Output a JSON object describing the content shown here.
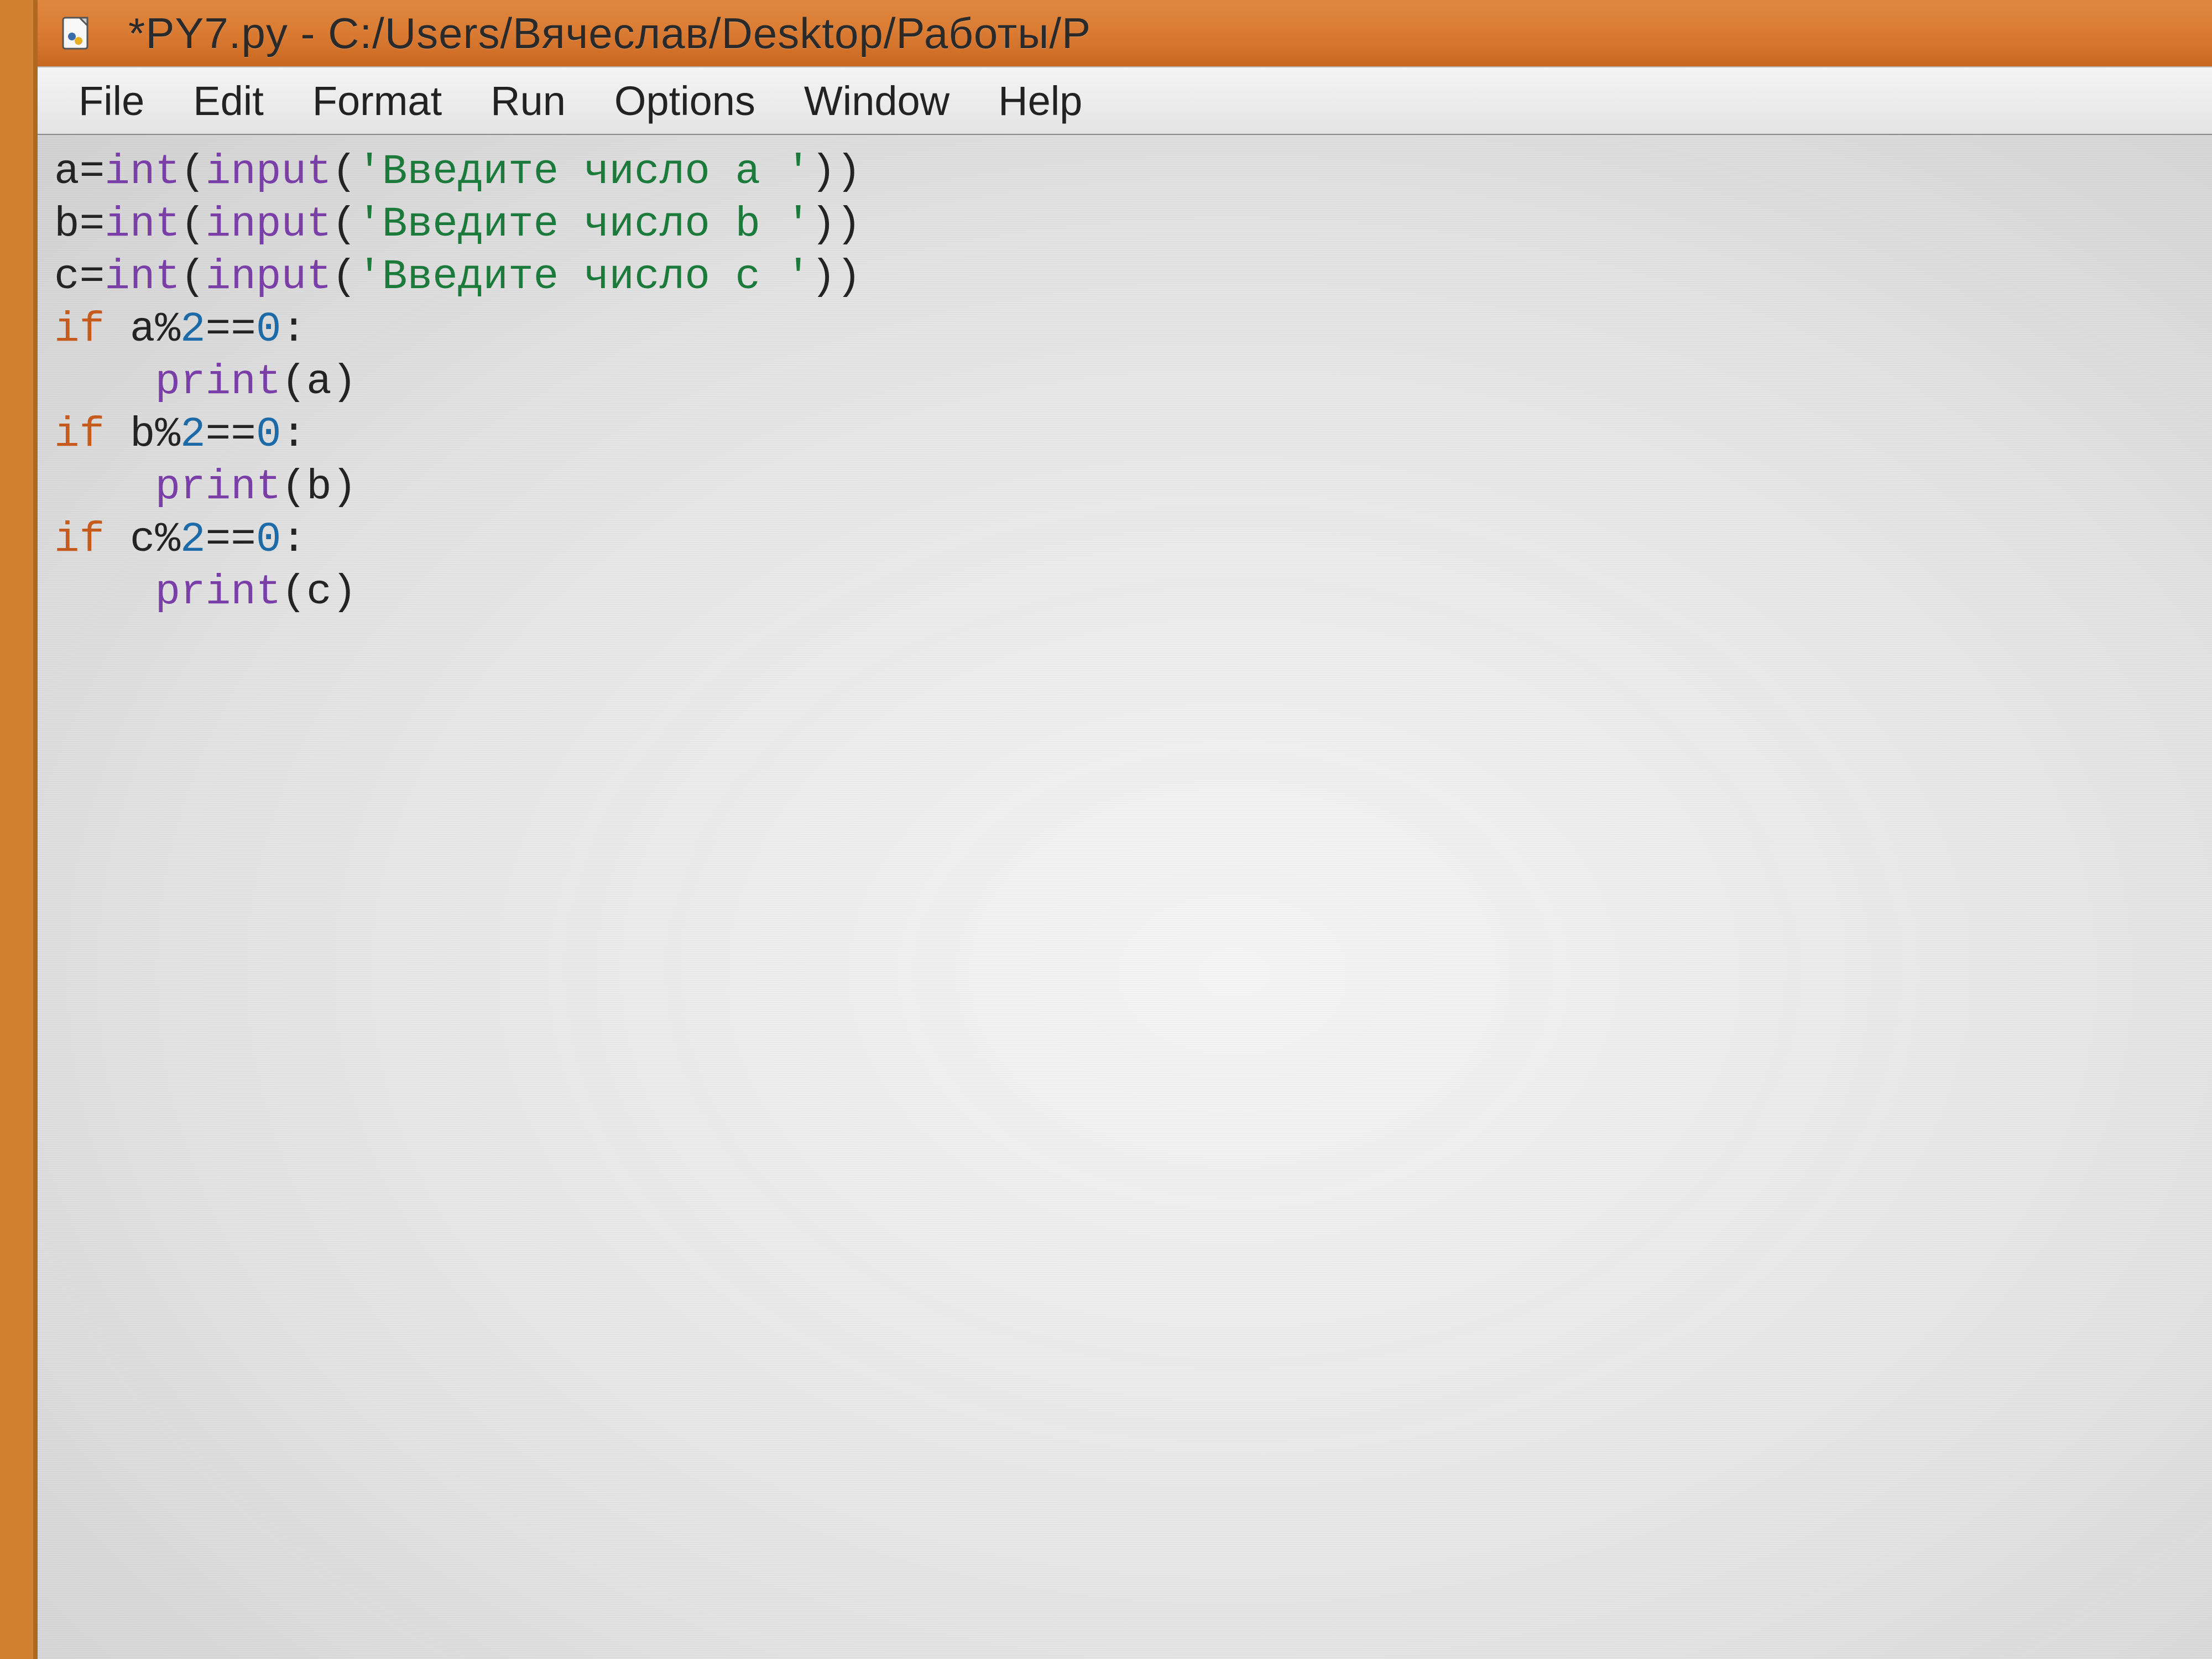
{
  "titlebar": {
    "text": "*PY7.py - C:/Users/Вячеслав/Desktop/Работы/P"
  },
  "menubar": {
    "items": [
      "File",
      "Edit",
      "Format",
      "Run",
      "Options",
      "Window",
      "Help"
    ]
  },
  "code": {
    "lines": [
      [
        {
          "t": "name",
          "v": "a"
        },
        {
          "t": "op",
          "v": "="
        },
        {
          "t": "builtin",
          "v": "int"
        },
        {
          "t": "op",
          "v": "("
        },
        {
          "t": "builtin",
          "v": "input"
        },
        {
          "t": "op",
          "v": "("
        },
        {
          "t": "string",
          "v": "'Введите число a '"
        },
        {
          "t": "op",
          "v": "))"
        }
      ],
      [
        {
          "t": "name",
          "v": "b"
        },
        {
          "t": "op",
          "v": "="
        },
        {
          "t": "builtin",
          "v": "int"
        },
        {
          "t": "op",
          "v": "("
        },
        {
          "t": "builtin",
          "v": "input"
        },
        {
          "t": "op",
          "v": "("
        },
        {
          "t": "string",
          "v": "'Введите число b '"
        },
        {
          "t": "op",
          "v": "))"
        }
      ],
      [
        {
          "t": "name",
          "v": "c"
        },
        {
          "t": "op",
          "v": "="
        },
        {
          "t": "builtin",
          "v": "int"
        },
        {
          "t": "op",
          "v": "("
        },
        {
          "t": "builtin",
          "v": "input"
        },
        {
          "t": "op",
          "v": "("
        },
        {
          "t": "string",
          "v": "'Введите число c '"
        },
        {
          "t": "op",
          "v": "))"
        }
      ],
      [
        {
          "t": "keyword",
          "v": "if"
        },
        {
          "t": "op",
          "v": " "
        },
        {
          "t": "name",
          "v": "a"
        },
        {
          "t": "op",
          "v": "%"
        },
        {
          "t": "number",
          "v": "2"
        },
        {
          "t": "op",
          "v": "=="
        },
        {
          "t": "number",
          "v": "0"
        },
        {
          "t": "op",
          "v": ":"
        }
      ],
      [
        {
          "t": "op",
          "v": "    "
        },
        {
          "t": "builtin",
          "v": "print"
        },
        {
          "t": "op",
          "v": "("
        },
        {
          "t": "name",
          "v": "a"
        },
        {
          "t": "op",
          "v": ")"
        }
      ],
      [
        {
          "t": "keyword",
          "v": "if"
        },
        {
          "t": "op",
          "v": " "
        },
        {
          "t": "name",
          "v": "b"
        },
        {
          "t": "op",
          "v": "%"
        },
        {
          "t": "number",
          "v": "2"
        },
        {
          "t": "op",
          "v": "=="
        },
        {
          "t": "number",
          "v": "0"
        },
        {
          "t": "op",
          "v": ":"
        }
      ],
      [
        {
          "t": "op",
          "v": "    "
        },
        {
          "t": "builtin",
          "v": "print"
        },
        {
          "t": "op",
          "v": "("
        },
        {
          "t": "name",
          "v": "b"
        },
        {
          "t": "op",
          "v": ")"
        }
      ],
      [
        {
          "t": "keyword",
          "v": "if"
        },
        {
          "t": "op",
          "v": " "
        },
        {
          "t": "name",
          "v": "c"
        },
        {
          "t": "op",
          "v": "%"
        },
        {
          "t": "number",
          "v": "2"
        },
        {
          "t": "op",
          "v": "=="
        },
        {
          "t": "number",
          "v": "0"
        },
        {
          "t": "op",
          "v": ":"
        }
      ],
      [
        {
          "t": "op",
          "v": "    "
        },
        {
          "t": "builtin",
          "v": "print"
        },
        {
          "t": "op",
          "v": "("
        },
        {
          "t": "name",
          "v": "c"
        },
        {
          "t": "op",
          "v": ")"
        }
      ]
    ]
  }
}
